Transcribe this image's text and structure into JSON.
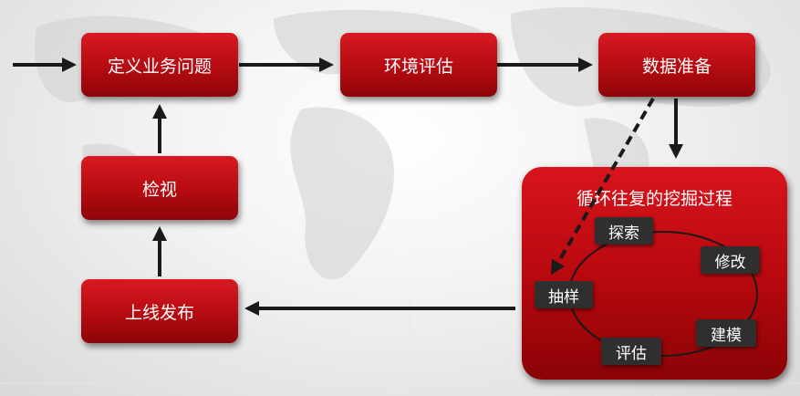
{
  "boxes": {
    "define": "定义业务问题",
    "env": "环境评估",
    "data": "数据准备",
    "review": "检视",
    "deploy": "上线发布"
  },
  "loop": {
    "title": "循环往复的挖掘过程",
    "steps": {
      "explore": "探索",
      "modify": "修改",
      "sample": "抽样",
      "model": "建模",
      "evaluate": "评估"
    }
  },
  "colors": {
    "box_red": "#c0101a",
    "tag_dark": "#2f2f2f",
    "arrow": "#1a1a1a"
  }
}
